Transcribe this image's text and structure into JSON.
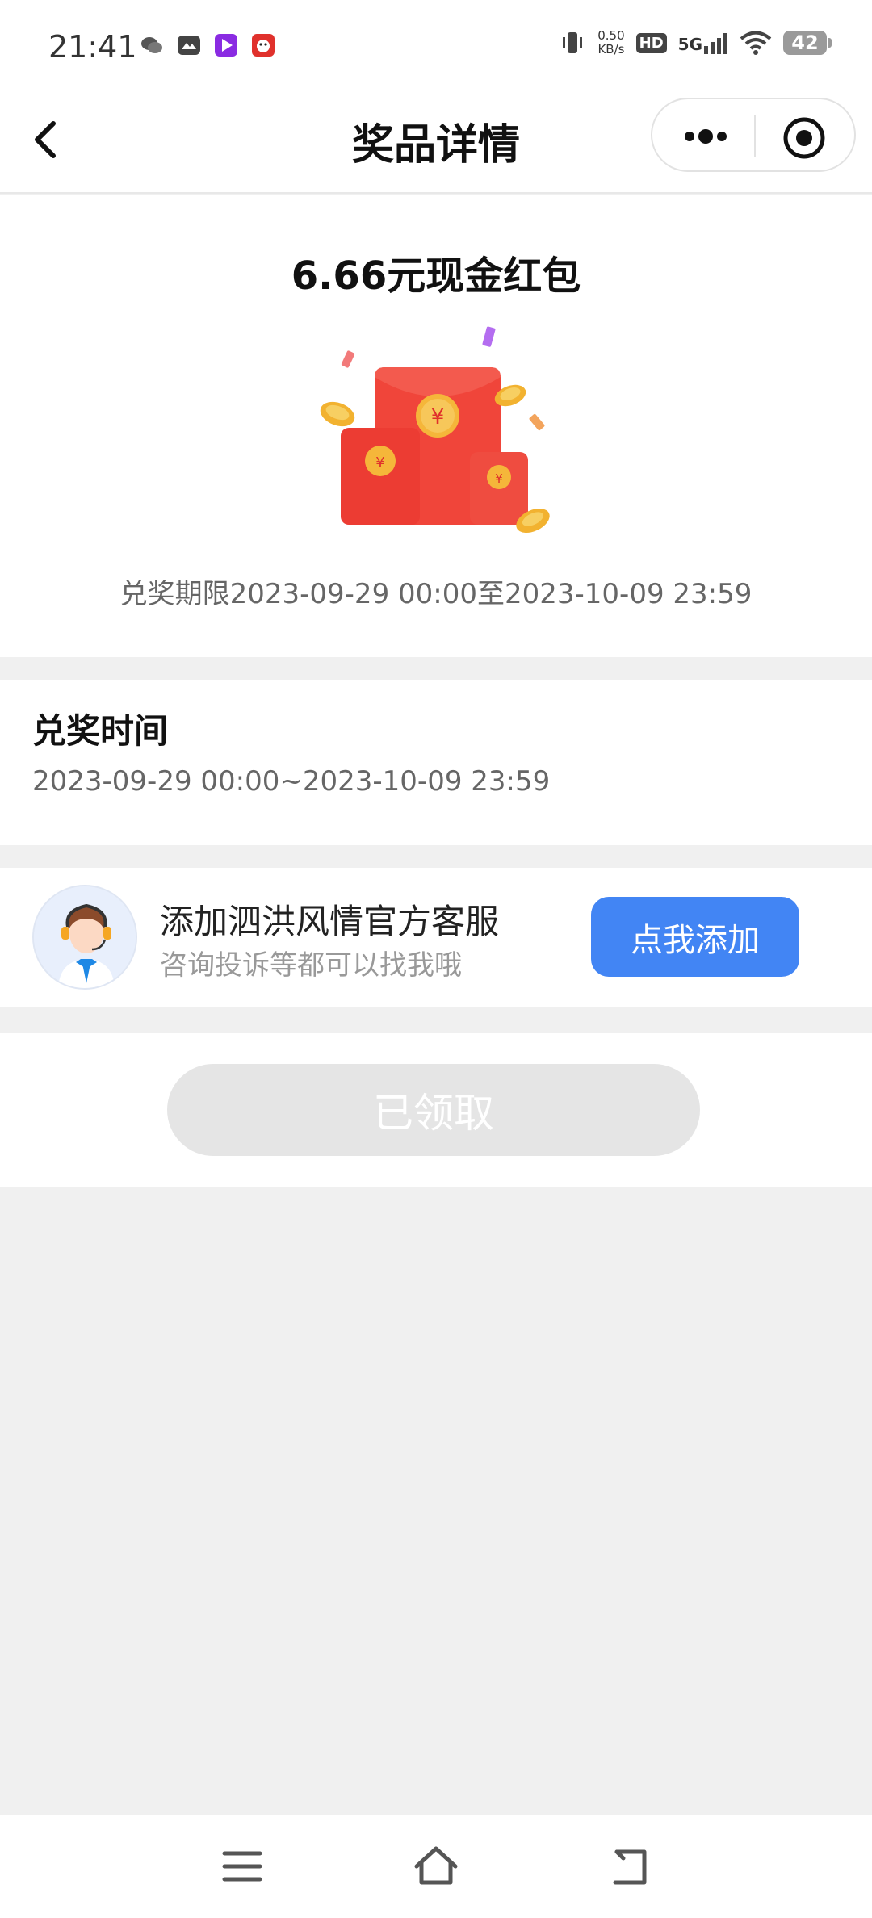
{
  "status_bar": {
    "time": "21:41",
    "speed_value": "0.50",
    "speed_unit": "KB/s",
    "hd": "HD",
    "network": "5G",
    "battery": "42"
  },
  "navbar": {
    "title": "奖品详情"
  },
  "prize": {
    "title": "6.66元现金红包",
    "period": "兑奖期限2023-09-29 00:00至2023-10-09 23:59"
  },
  "redeem_time": {
    "label": "兑奖时间",
    "value": "2023-09-29 00:00~2023-10-09 23:59"
  },
  "service": {
    "title": "添加泗洪风情官方客服",
    "subtitle": "咨询投诉等都可以找我哦",
    "button": "点我添加"
  },
  "claim": {
    "button": "已领取"
  },
  "colors": {
    "accent": "#4285f4",
    "red_envelope": "#f0453a",
    "coin": "#f5b63a",
    "page_bg": "#f0f0f0"
  }
}
